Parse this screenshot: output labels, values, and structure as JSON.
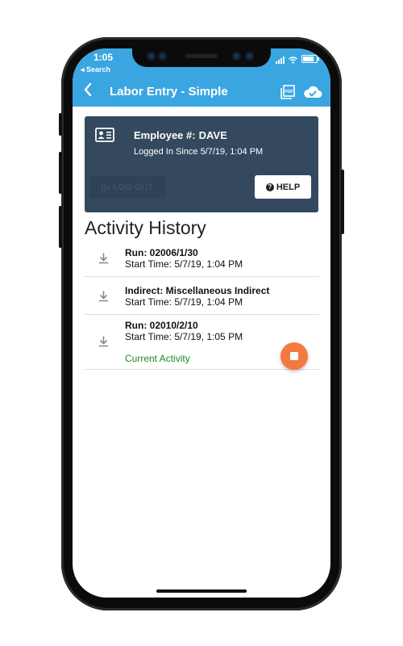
{
  "status_bar": {
    "time": "1:05",
    "back_label": "◂ Search"
  },
  "navbar": {
    "title": "Labor Entry - Simple",
    "back_icon": "chevron-left-icon",
    "pdf_icon": "pdf-icon",
    "cloud_icon": "cloud-check-icon"
  },
  "employee_card": {
    "employee_label": "Employee #:",
    "employee_id": "DAVE",
    "logged_in_text": "Logged In Since 5/7/19, 1:04 PM",
    "logout_label": "LOG OUT",
    "logout_enabled": false,
    "help_label": "HELP",
    "card_color": "#34495e"
  },
  "activity_history": {
    "title": "Activity History",
    "items": [
      {
        "title": "Run: 02006/1/30",
        "start_time": "Start Time: 5/7/19, 1:04 PM",
        "current": ""
      },
      {
        "title": "Indirect: Miscellaneous Indirect",
        "start_time": "Start Time: 5/7/19, 1:04 PM",
        "current": ""
      },
      {
        "title": "Run: 02010/2/10",
        "start_time": "Start Time: 5/7/19, 1:05 PM",
        "current": "Current Activity"
      }
    ]
  },
  "colors": {
    "accent": "#3aa6e1",
    "stop_button": "#f37a3f",
    "current_activity": "#1f8a1f"
  }
}
